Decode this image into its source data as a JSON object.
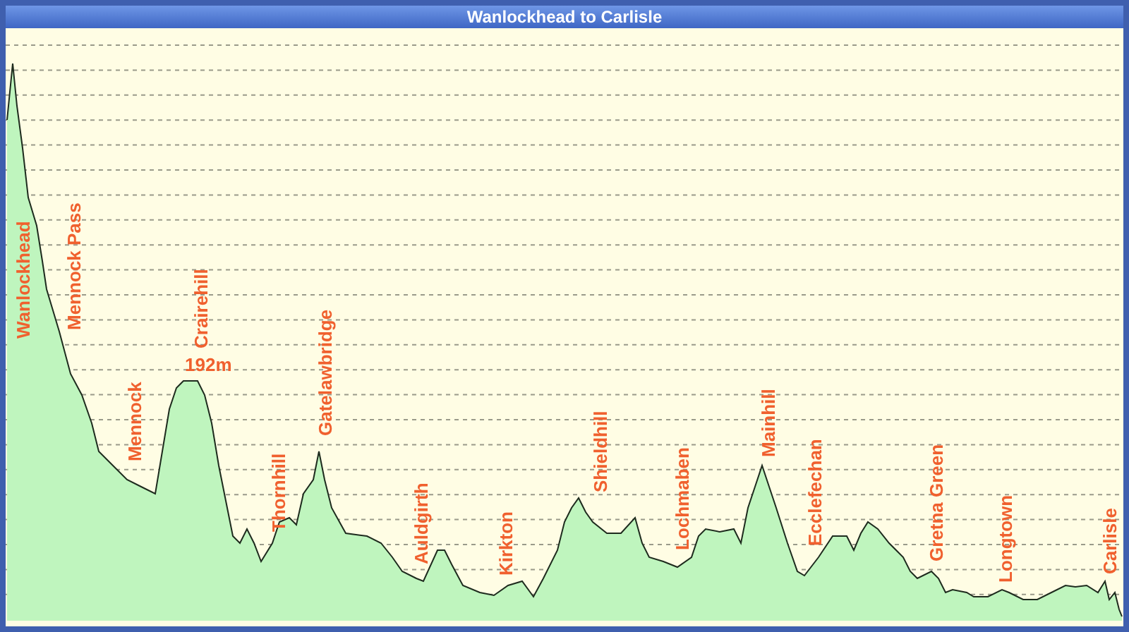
{
  "title": "Wanlockhead to Carlisle",
  "chart": {
    "place_labels": [
      "Wanlockhead",
      "Mennock Pass",
      "Mennock",
      "Crairehill",
      "Thornhill",
      "Gatelawbridge",
      "Auldgirth",
      "Kirkton",
      "Shieldhill",
      "Lochmaben",
      "Mainhill",
      "Ecclefechan",
      "Gretna Green",
      "Longtown",
      "Carlisle"
    ],
    "peak_label": "192m"
  }
}
